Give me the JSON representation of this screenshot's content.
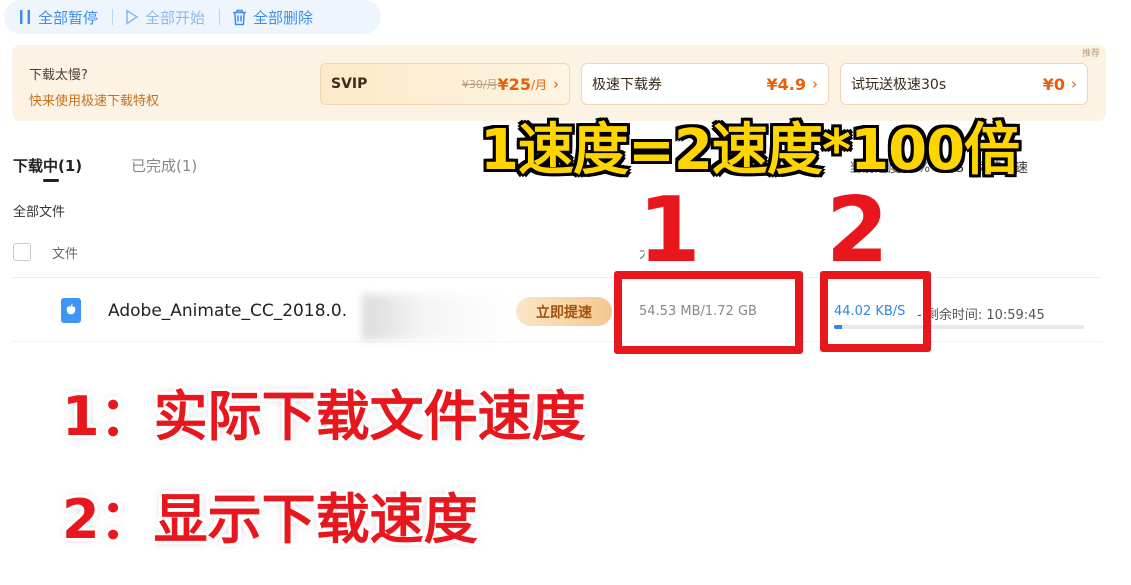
{
  "toolbar": {
    "pause_all": "全部暂停",
    "start_all": "全部开始",
    "delete_all": "全部删除"
  },
  "promo": {
    "title": "下载太慢?",
    "subtitle": "快来使用极速下载特权",
    "badge": "推荐",
    "offers": [
      {
        "name": "SVIP",
        "old_price": "¥30/月",
        "price": "¥25",
        "unit": "/月"
      },
      {
        "name": "极速下载券",
        "price": "¥4.9"
      },
      {
        "name": "试玩送极速30s",
        "price": "¥0"
      }
    ]
  },
  "tabs": {
    "downloading": "下载中(1)",
    "completed": "已完成(1)"
  },
  "right_info": {
    "progress": "当前进度: 3%",
    "speed": "B/S",
    "free_boost": "免费加速"
  },
  "section": {
    "all_files": "全部文件"
  },
  "columns": {
    "file": "文件",
    "size": "大小"
  },
  "file": {
    "name": "Adobe_Animate_CC_2018.0.",
    "speedup": "立即提速",
    "size": "54.53 MB/1.72 GB",
    "speed": "44.02 KB/S",
    "remaining": "- 剩余时间: 10:59:45",
    "progress_fraction": 0.03
  },
  "annotation": {
    "title": "1速度=2速度*100倍",
    "num1": "1",
    "num2": "2",
    "note1": "1：实际下载文件速度",
    "note2": "2：显示下载速度"
  },
  "colors": {
    "accent": "#3b8ef0",
    "annotation_red": "#e8161d",
    "annotation_yellow": "#ffd500",
    "promo_bg": "#fdf3e5",
    "price_orange": "#e85f0a"
  }
}
